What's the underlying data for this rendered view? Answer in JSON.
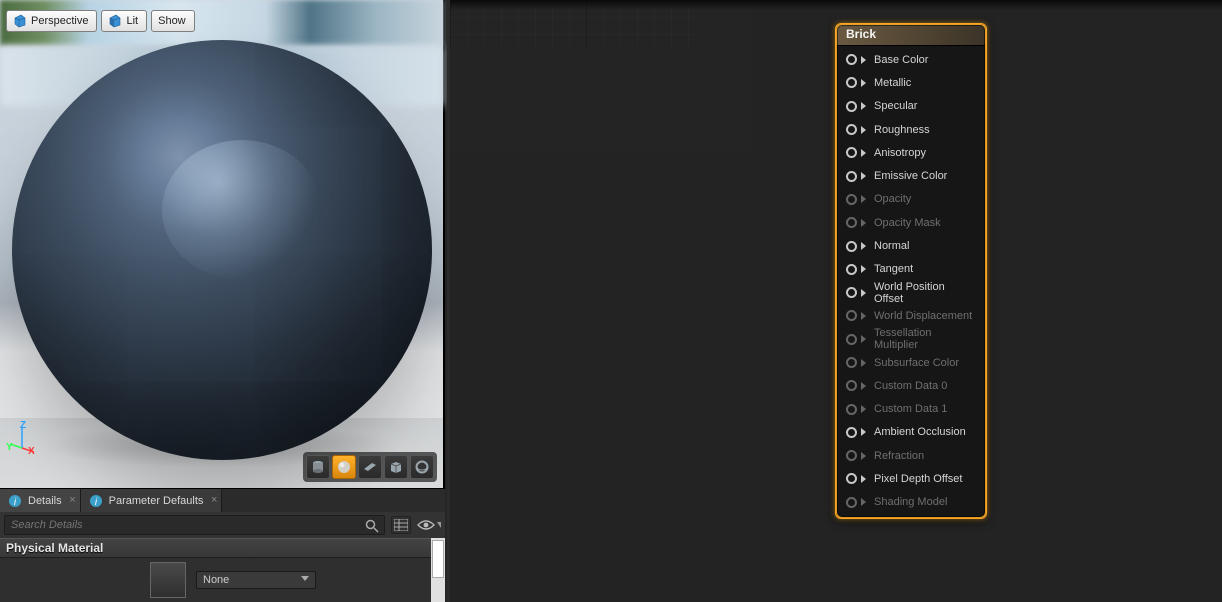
{
  "viewport": {
    "buttons": {
      "perspective": "Perspective",
      "lit": "Lit",
      "show": "Show"
    },
    "gizmo": {
      "x": "X",
      "y": "Y",
      "z": "Z"
    },
    "mode_icons": [
      "cube",
      "sphere",
      "plane",
      "cylinder",
      "disc"
    ],
    "active_mode_index": 1
  },
  "tabs": [
    {
      "id": "details",
      "label": "Details",
      "icon": "info",
      "active": true
    },
    {
      "id": "param-defaults",
      "label": "Parameter Defaults",
      "icon": "info",
      "active": false
    }
  ],
  "search": {
    "placeholder": "Search Details"
  },
  "details": {
    "section_title": "Physical Material",
    "dropdown_value": "None"
  },
  "node": {
    "title": "Brick",
    "pins": [
      {
        "label": "Base Color",
        "enabled": true
      },
      {
        "label": "Metallic",
        "enabled": true
      },
      {
        "label": "Specular",
        "enabled": true
      },
      {
        "label": "Roughness",
        "enabled": true
      },
      {
        "label": "Anisotropy",
        "enabled": true
      },
      {
        "label": "Emissive Color",
        "enabled": true
      },
      {
        "label": "Opacity",
        "enabled": false
      },
      {
        "label": "Opacity Mask",
        "enabled": false
      },
      {
        "label": "Normal",
        "enabled": true
      },
      {
        "label": "Tangent",
        "enabled": true
      },
      {
        "label": "World Position Offset",
        "enabled": true
      },
      {
        "label": "World Displacement",
        "enabled": false
      },
      {
        "label": "Tessellation Multiplier",
        "enabled": false
      },
      {
        "label": "Subsurface Color",
        "enabled": false
      },
      {
        "label": "Custom Data 0",
        "enabled": false
      },
      {
        "label": "Custom Data 1",
        "enabled": false
      },
      {
        "label": "Ambient Occlusion",
        "enabled": true
      },
      {
        "label": "Refraction",
        "enabled": false
      },
      {
        "label": "Pixel Depth Offset",
        "enabled": true
      },
      {
        "label": "Shading Model",
        "enabled": false
      }
    ]
  }
}
